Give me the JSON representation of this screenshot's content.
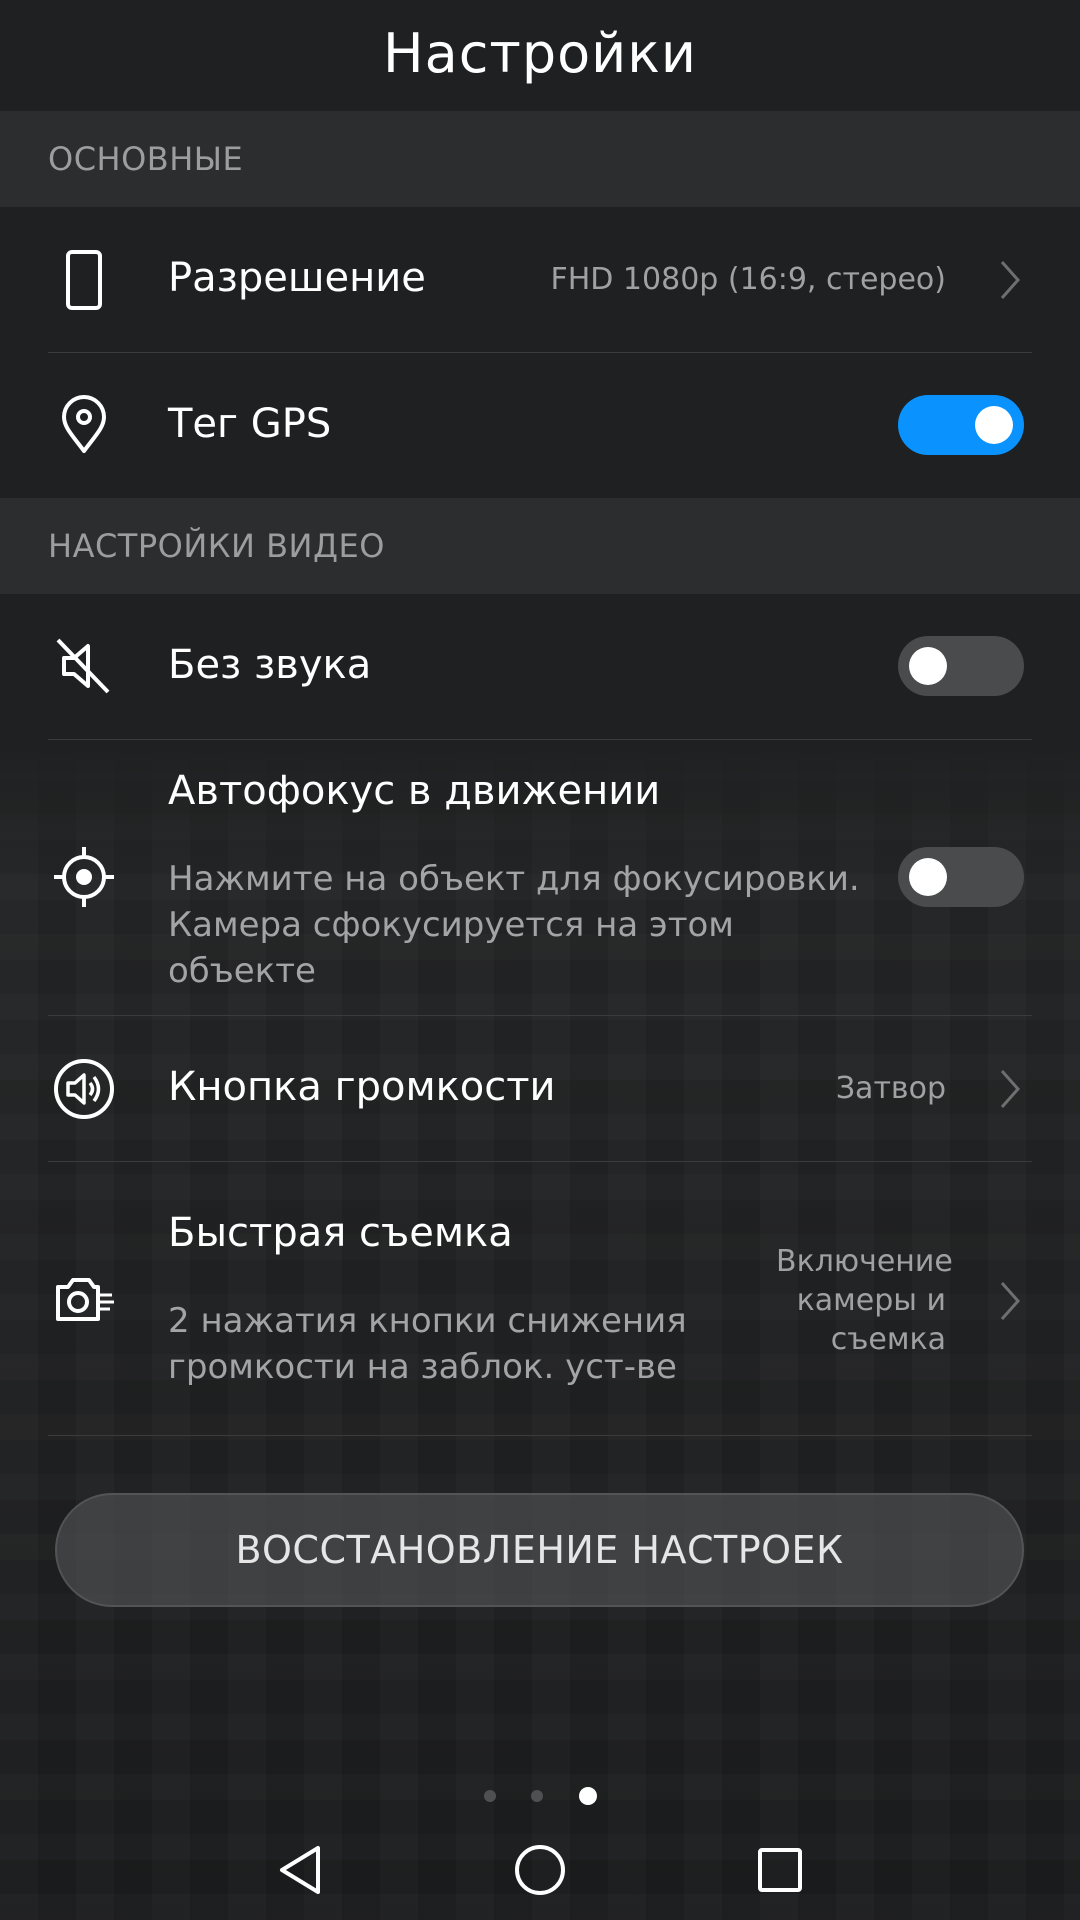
{
  "header": {
    "title": "Настройки"
  },
  "sections": {
    "basic": {
      "label": "ОСНОВНЫЕ"
    },
    "video": {
      "label": "НАСТРОЙКИ ВИДЕО"
    }
  },
  "rows": {
    "resolution": {
      "title": "Разрешение",
      "value": "FHD 1080p (16:9, стерео)",
      "icon": "phone-icon"
    },
    "gps": {
      "title": "Тег GPS",
      "toggle": true,
      "icon": "location-pin-icon"
    },
    "mute": {
      "title": "Без звука",
      "toggle": false,
      "icon": "mute-icon"
    },
    "autofocus": {
      "title": "Автофокус в движении",
      "description": "Нажмите на объект для фокусировки. Камера сфокусируется на этом объекте",
      "toggle": false,
      "icon": "target-icon"
    },
    "volume_button": {
      "title": "Кнопка громкости",
      "value": "Затвор",
      "icon": "speaker-icon"
    },
    "quick_shot": {
      "title": "Быстрая съемка",
      "description": "2 нажатия кнопки снижения громкости на заблок. уст-ве",
      "value": "Включение камеры и съемка",
      "icon": "quick-camera-icon"
    }
  },
  "reset_button": {
    "label": "ВОССТАНОВЛЕНИЕ НАСТРОЕК"
  },
  "pager": {
    "count": 3,
    "active": 3
  },
  "navbar": {
    "back": "back-icon",
    "home": "home-icon",
    "recents": "recents-icon"
  },
  "colors": {
    "accent": "#0a93ff",
    "background": "#1f2021",
    "section_background": "#2c2d2e",
    "secondary_text": "#a3a4a5"
  }
}
